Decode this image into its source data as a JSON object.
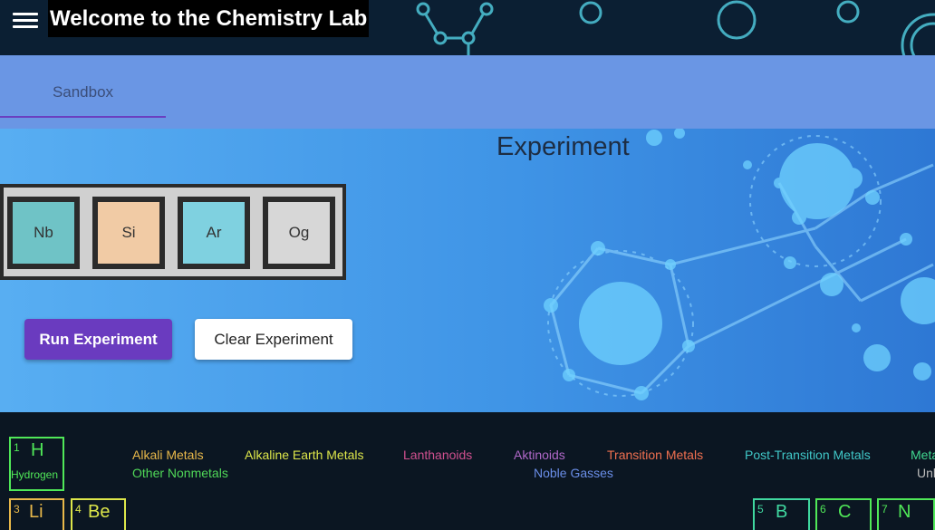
{
  "header": {
    "title": "Welcome to the Chemistry Lab",
    "menu_icon": "menu-icon"
  },
  "tabs": [
    {
      "label": "Sandbox",
      "active": true
    }
  ],
  "experiment": {
    "title": "Experiment",
    "slots": [
      {
        "symbol": "Nb",
        "color": "#6fc3c6"
      },
      {
        "symbol": "Si",
        "color": "#f1cba5"
      },
      {
        "symbol": "Ar",
        "color": "#7fd1e0"
      },
      {
        "symbol": "Og",
        "color": "#d7d7d7"
      }
    ],
    "run_label": "Run Experiment",
    "clear_label": "Clear Experiment"
  },
  "legend": [
    {
      "label": "Alkali Metals",
      "color": "#e8b84a"
    },
    {
      "label": "Alkaline Earth Metals",
      "color": "#dde64a"
    },
    {
      "label": "Lanthanoids",
      "color": "#d0508f"
    },
    {
      "label": "Aktinoids",
      "color": "#b068c8"
    },
    {
      "label": "Transition Metals",
      "color": "#f07050"
    },
    {
      "label": "Post-Transition Metals",
      "color": "#40c8c8"
    },
    {
      "label": "Meta",
      "color": "#40d890"
    },
    {
      "label": "Other Nonmetals",
      "color": "#50d858"
    },
    {
      "label": "Noble Gasses",
      "color": "#6a8ee8"
    },
    {
      "label": "Unk",
      "color": "#bbbbbb"
    }
  ],
  "elements": [
    {
      "number": "1",
      "symbol": "H",
      "name": "Hydrogen",
      "color": "#50e858"
    },
    {
      "number": "3",
      "symbol": "Li",
      "color": "#e8b84a"
    },
    {
      "number": "4",
      "symbol": "Be",
      "color": "#dde64a"
    },
    {
      "number": "5",
      "symbol": "B",
      "color": "#40d8a0"
    },
    {
      "number": "6",
      "symbol": "C",
      "color": "#50e858"
    },
    {
      "number": "7",
      "symbol": "N",
      "color": "#50e858"
    }
  ]
}
